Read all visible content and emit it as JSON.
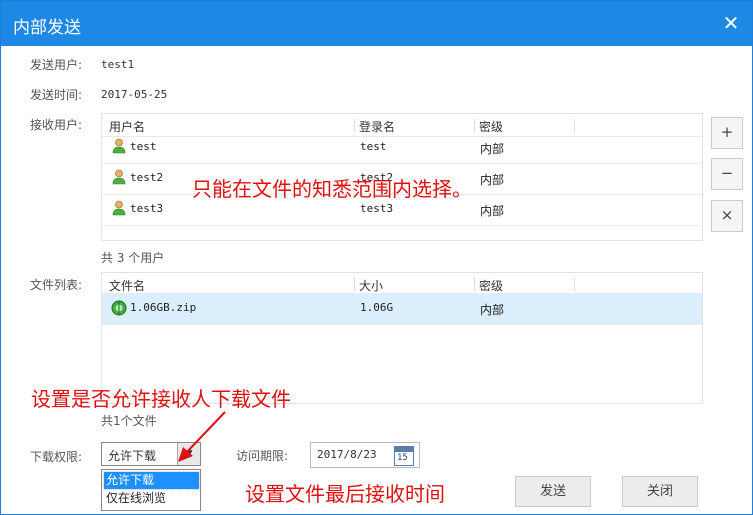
{
  "window": {
    "title": "内部发送",
    "close_glyph": "✕"
  },
  "form": {
    "sender_label": "发送用户:",
    "sender_value": "test1",
    "time_label": "发送时间:",
    "time_value": "2017-05-25",
    "receivers_label": "接收用户:",
    "files_label": "文件列表:",
    "download_label": "下载权限:",
    "expiry_label": "访问期限:"
  },
  "users_table": {
    "headers": [
      "用户名",
      "登录名",
      "密级"
    ],
    "rows": [
      {
        "username": "test",
        "login": "test",
        "level": "内部",
        "icon": "user-icon"
      },
      {
        "username": "test2",
        "login": "test2",
        "level": "内部",
        "icon": "user-icon"
      },
      {
        "username": "test3",
        "login": "test3",
        "level": "内部",
        "icon": "user-icon"
      }
    ],
    "count_text": "共 3 个用户"
  },
  "side_buttons": {
    "add": "+",
    "remove": "−",
    "clear": "×"
  },
  "files_table": {
    "headers": [
      "文件名",
      "大小",
      "密级"
    ],
    "rows": [
      {
        "name": "1.06GB.zip",
        "size": "1.06G",
        "level": "内部",
        "icon": "zip-file-icon",
        "selected": true
      }
    ],
    "count_text": "共1个文件"
  },
  "download_permission": {
    "selected": "允许下载",
    "options": [
      "允许下载",
      "仅在线浏览"
    ],
    "arrow_glyph": "▼"
  },
  "expiry": {
    "value": "2017/8/23",
    "calendar_day": "15"
  },
  "buttons": {
    "send": "发送",
    "close": "关闭"
  },
  "annotations": {
    "scope_note": "只能在文件的知悉范围内选择。",
    "download_note": "设置是否允许接收人下载文件",
    "expiry_note": "设置文件最后接收时间"
  },
  "colors": {
    "titlebar": "#1e88e5",
    "annotation": "#e01010",
    "selection": "#dbeefb"
  }
}
